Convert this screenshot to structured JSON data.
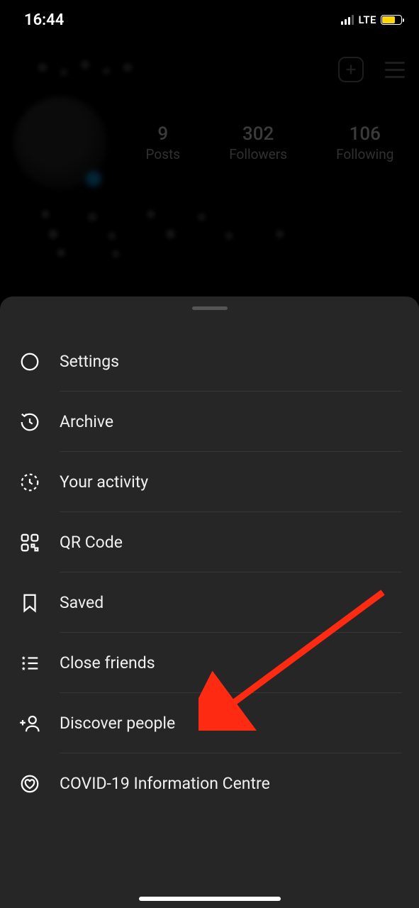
{
  "status_bar": {
    "time": "16:44",
    "network": "LTE"
  },
  "profile": {
    "stats": {
      "posts_count": "9",
      "posts_label": "Posts",
      "followers_count": "302",
      "followers_label": "Followers",
      "following_count": "106",
      "following_label": "Following"
    }
  },
  "menu": {
    "items": [
      {
        "label": "Settings",
        "icon": "settings-icon"
      },
      {
        "label": "Archive",
        "icon": "archive-icon"
      },
      {
        "label": "Your activity",
        "icon": "activity-icon"
      },
      {
        "label": "QR Code",
        "icon": "qr-code-icon"
      },
      {
        "label": "Saved",
        "icon": "saved-icon"
      },
      {
        "label": "Close friends",
        "icon": "close-friends-icon"
      },
      {
        "label": "Discover people",
        "icon": "discover-people-icon"
      },
      {
        "label": "COVID-19 Information Centre",
        "icon": "covid-info-icon"
      }
    ]
  },
  "annotation": {
    "highlight_item": "Discover people",
    "arrow_color": "#ff2a12"
  }
}
